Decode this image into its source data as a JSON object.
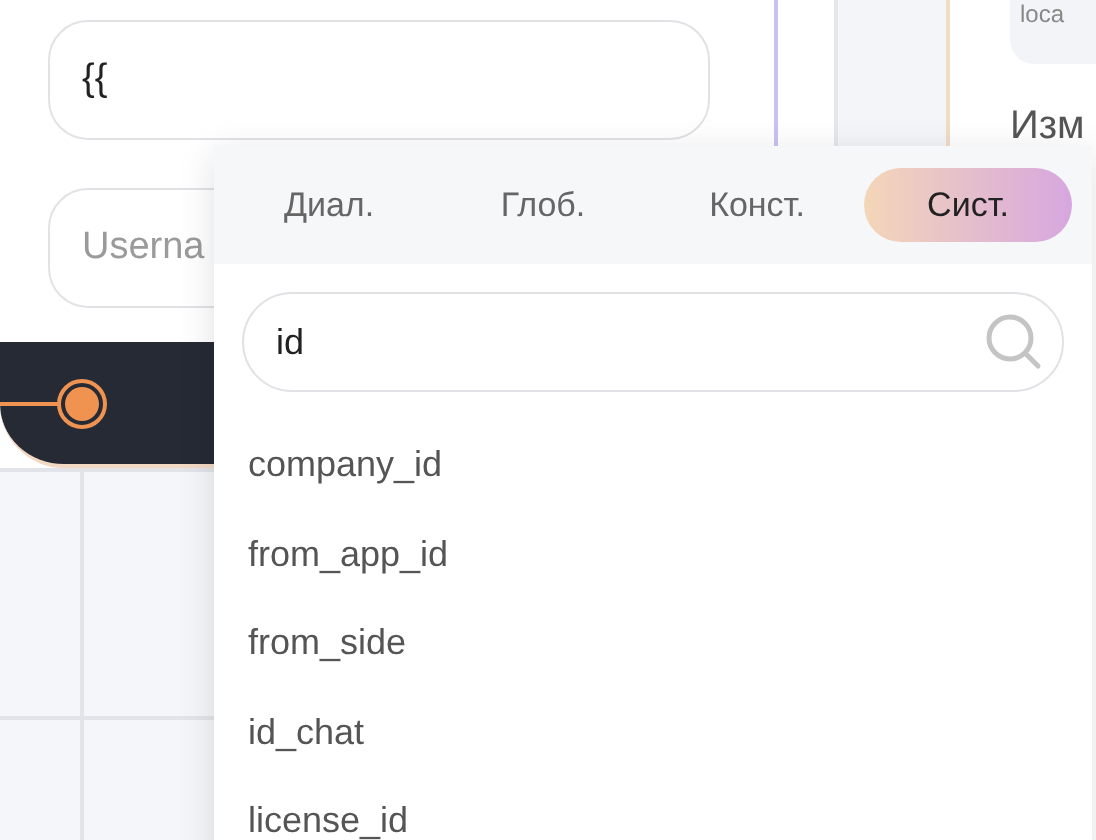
{
  "editor": {
    "fields": [
      {
        "value": "{{"
      },
      {
        "placeholder": "Userna"
      }
    ]
  },
  "side_panel": {
    "card_text": "loca",
    "heading": "Изм"
  },
  "variable_picker": {
    "tabs": [
      {
        "label": "Диал.",
        "selected": false
      },
      {
        "label": "Глоб.",
        "selected": false
      },
      {
        "label": "Конст.",
        "selected": false
      },
      {
        "label": "Сист.",
        "selected": true
      }
    ],
    "search": {
      "value": "id"
    },
    "items": [
      "company_id",
      "from_app_id",
      "from_side",
      "id_chat",
      "license_id"
    ]
  }
}
